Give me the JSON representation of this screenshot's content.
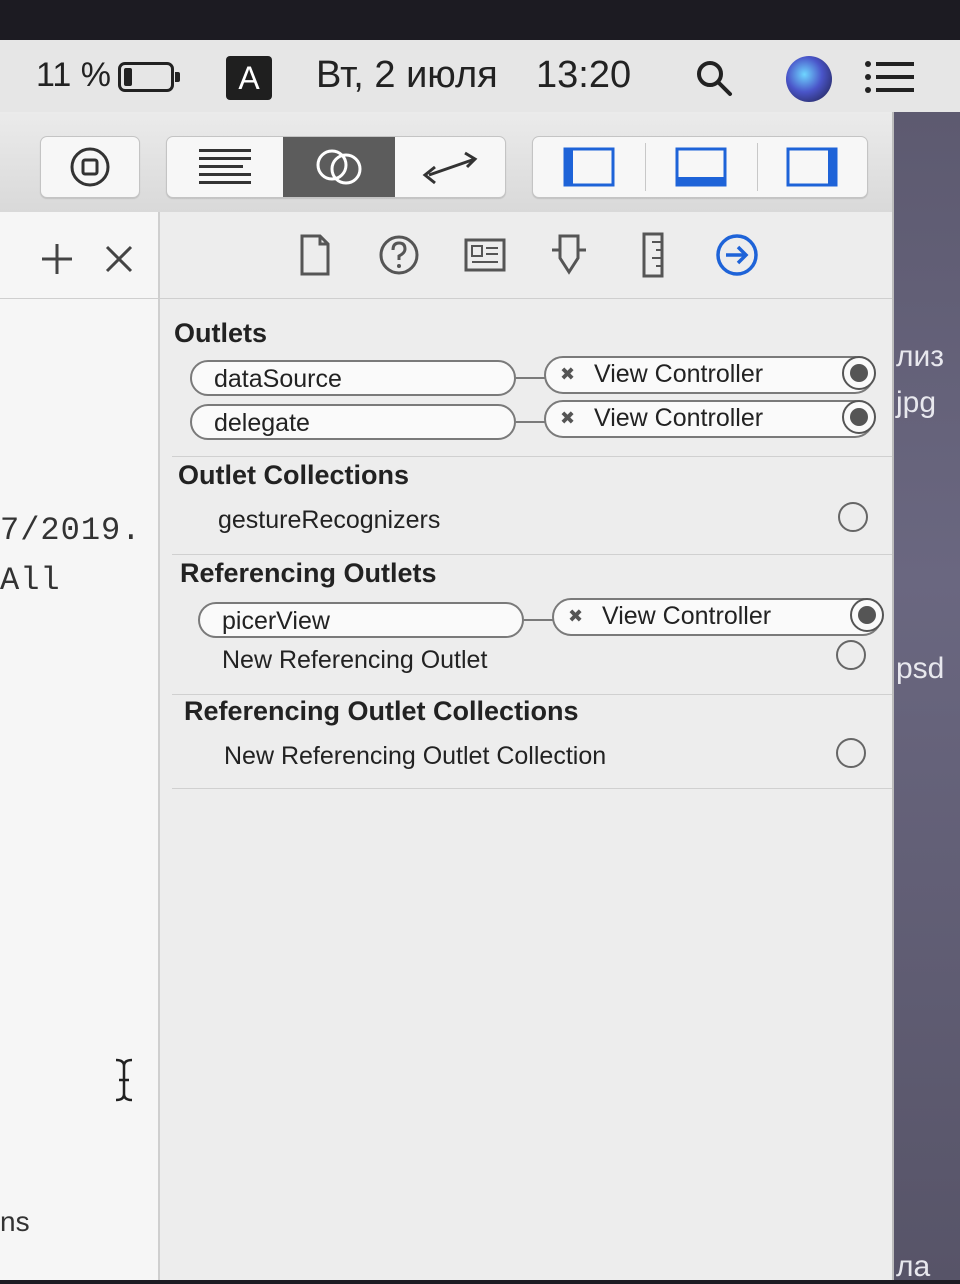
{
  "menubar": {
    "battery_percent": "11 %",
    "input_source": "A",
    "date": "Вт, 2 июля",
    "time": "13:20"
  },
  "desktop": {
    "items": [
      "лиз",
      "jpg",
      "psd",
      "ла"
    ]
  },
  "editor": {
    "code_line_1": "7/2019.",
    "code_line_2": "All",
    "code_line_3": "ns"
  },
  "inspector": {
    "outlets": {
      "title": "Outlets",
      "items": [
        {
          "name": "dataSource",
          "target": "View Controller"
        },
        {
          "name": "delegate",
          "target": "View Controller"
        }
      ]
    },
    "outlet_collections": {
      "title": "Outlet Collections",
      "items": [
        {
          "name": "gestureRecognizers"
        }
      ]
    },
    "referencing_outlets": {
      "title": "Referencing Outlets",
      "items": [
        {
          "name": "picerView",
          "target": "View Controller"
        }
      ],
      "new_label": "New Referencing Outlet"
    },
    "referencing_outlet_collections": {
      "title": "Referencing Outlet Collections",
      "new_label": "New Referencing Outlet Collection"
    }
  },
  "colors": {
    "accent": "#1e63d8",
    "selected_segment": "#5c5c5c"
  }
}
